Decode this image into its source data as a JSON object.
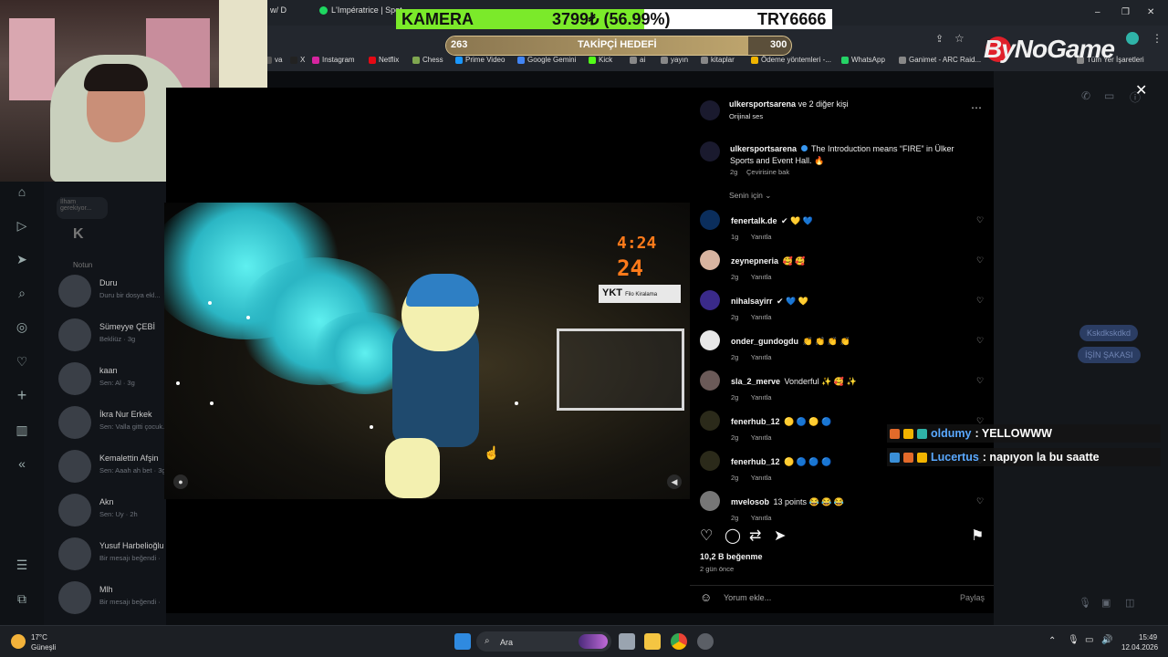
{
  "browser": {
    "tabs": [
      "w/ D",
      "L'Impératrice | Spot"
    ],
    "bookmarks": [
      {
        "label": "va",
        "color": "#555555"
      },
      {
        "label": "X",
        "color": "#222222"
      },
      {
        "label": "Instagram",
        "color": "#d6249f"
      },
      {
        "label": "Netflix",
        "color": "#e50914"
      },
      {
        "label": "Chess",
        "color": "#7fa650"
      },
      {
        "label": "Prime Video",
        "color": "#1a98ff"
      },
      {
        "label": "Google Gemini",
        "color": "#4285f4"
      },
      {
        "label": "Kick",
        "color": "#53fc18"
      },
      {
        "label": "ai",
        "color": "#888888"
      },
      {
        "label": "yayın",
        "color": "#888888"
      },
      {
        "label": "kitaplar",
        "color": "#888888"
      },
      {
        "label": "Ödeme yöntemleri -...",
        "color": "#f0b400"
      },
      {
        "label": "WhatsApp",
        "color": "#25d366"
      },
      {
        "label": "Ganimet - ARC Raid...",
        "color": "#888888"
      },
      {
        "label": "Tüm Yer İşaretleri",
        "color": "#888888"
      }
    ],
    "window_controls": [
      "–",
      "❐",
      "✕"
    ]
  },
  "overlay": {
    "kamera_label": "KAMERA",
    "kamera_value": "3799₺ (56.99%)",
    "kamera_progress": 0.5699,
    "kamera_goal": "TRY6666",
    "follow_title": "TAKİPÇİ HEDEFİ",
    "follow_current": "263",
    "follow_target": "300",
    "logo": "ByNoGame"
  },
  "ig_nav": {
    "icons": [
      "home-icon",
      "reels-icon",
      "send-icon",
      "search-icon",
      "explore-icon",
      "heart-icon",
      "create-icon",
      "stats-icon",
      "collapse-icon",
      "menu-icon",
      "apps-icon"
    ],
    "note_placeholder": "İlham gerekiyor...",
    "note_label": "Notun"
  },
  "dm_list": [
    {
      "name": "Duru",
      "sub": "Duru bir dosya ekl..."
    },
    {
      "name": "Sümeyye ÇEBİ",
      "sub": "Bekliüz · 3g"
    },
    {
      "name": "kaan",
      "sub": "Sen: Al · 3g"
    },
    {
      "name": "İkra Nur Erkek",
      "sub": "Sen: Valla gitti çocuk..."
    },
    {
      "name": "Kemalettin Afşin",
      "sub": "Sen: Aaah ah bet · 3g"
    },
    {
      "name": "Akn",
      "sub": "Sen: Uy · 2h"
    },
    {
      "name": "Yusuf Harbelioğlu",
      "sub": "Bir mesajı beğendi ·"
    },
    {
      "name": "Mlh",
      "sub": "Bir mesajı beğendi ·"
    }
  ],
  "video": {
    "clock": "4:24",
    "shot_clock": "24",
    "sponsor": "YKT",
    "sponsor_sub": "Filo Kiralama"
  },
  "post": {
    "header_user": "ulkersportsarena",
    "header_others": "ve 2 diğer kişi",
    "audio": "Orijinal ses",
    "caption_user": "ulkersportsarena",
    "caption_text": "The Introduction means “FIRE” in Ülker Sports and Event Hall. 🔥",
    "caption_age": "2g",
    "caption_translate": "Çevirisine bak",
    "sort_label": "Senin için ⌄",
    "likes": "10,2 B beğenme",
    "posted": "2 gün önce",
    "comment_placeholder": "Yorum ekle...",
    "share_label": "Paylaş"
  },
  "comments": [
    {
      "user": "fenertalk.de",
      "text": "✔ 💛 💙",
      "age": "1g",
      "reply": "Yanıtla",
      "avatar_color": "#0b2e5c"
    },
    {
      "user": "zeynepneria",
      "text": "🥰 🥰",
      "age": "2g",
      "reply": "Yanıtla",
      "avatar_color": "#d8b4a0"
    },
    {
      "user": "nihalsayirr",
      "text": "✔ 💙 💛",
      "age": "2g",
      "reply": "Yanıtla",
      "avatar_color": "#3a2a8a"
    },
    {
      "user": "onder_gundogdu",
      "text": "👏 👏 👏 👏",
      "age": "2g",
      "reply": "Yanıtla",
      "avatar_color": "#e8e8e8"
    },
    {
      "user": "sla_2_merve",
      "text": "Vonderful ✨ 🥰 ✨",
      "age": "2g",
      "reply": "Yanıtla",
      "avatar_color": "#6b5a58"
    },
    {
      "user": "fenerhub_12",
      "text": "🟡 🔵 🟡 🔵",
      "age": "2g",
      "reply": "Yanıtla",
      "avatar_color": "#2b2a1a"
    },
    {
      "user": "fenerhub_12",
      "text": "🟡 🔵 🔵 🔵",
      "age": "2g",
      "reply": "Yanıtla",
      "avatar_color": "#2b2a1a"
    },
    {
      "user": "mvelosob",
      "text": "13 points 😂 😂 😂",
      "age": "2g",
      "reply": "Yanıtla",
      "avatar_color": "#777777"
    }
  ],
  "dm_bubbles": [
    "Kskdkskdkd",
    "İŞİN ŞAKASI"
  ],
  "chat": [
    {
      "user": "oldumy",
      "user_color": "#5aa9ff",
      "message": ": YELLOWWW"
    },
    {
      "user": "Lucertus",
      "user_color": "#5aa9ff",
      "message": ": napıyon la bu saatte"
    }
  ],
  "taskbar": {
    "weather_temp": "17°C",
    "weather_desc": "Güneşli",
    "search_placeholder": "Ara",
    "time": "15:49",
    "date": "12.04.2026"
  }
}
